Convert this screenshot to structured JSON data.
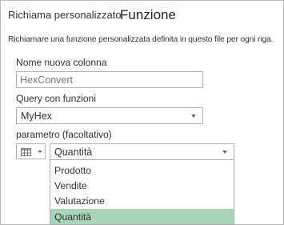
{
  "dialog": {
    "small_title": "Richiama personalizzato",
    "title": "Funzione",
    "description": "Richiamare una funzione personalizzata definita in questo file per ogni riga."
  },
  "new_column": {
    "label": "Nome nuova colonna",
    "value": "HexConvert"
  },
  "query": {
    "label": "Query con funzioni",
    "selected": "MyHex"
  },
  "parameter": {
    "label": "parametro (facoltativo)",
    "type_icon": "table-icon",
    "selected": "Quantità",
    "options": [
      "Prodotto",
      "Vendite",
      "Valutazione",
      "Quantità"
    ]
  },
  "colors": {
    "selected_option_bg": "#a8d5b9",
    "border": "#b4b4b4"
  }
}
